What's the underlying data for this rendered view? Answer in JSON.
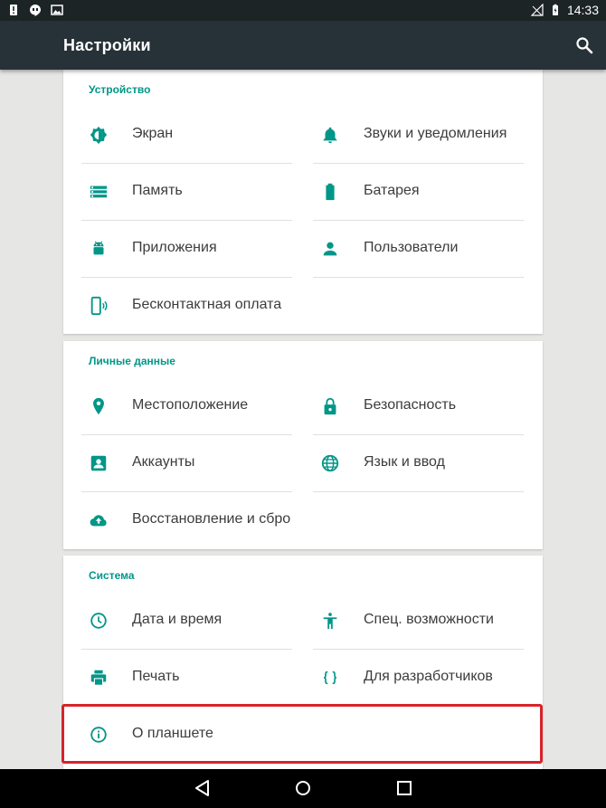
{
  "status_bar": {
    "time": "14:33"
  },
  "app_bar": {
    "title": "Настройки"
  },
  "sections": [
    {
      "title": "Устройство",
      "items": [
        {
          "label": "Экран",
          "icon": "brightness-icon"
        },
        {
          "label": "Звуки и уведомления",
          "icon": "bell-icon"
        },
        {
          "label": "Память",
          "icon": "storage-icon"
        },
        {
          "label": "Батарея",
          "icon": "battery-icon"
        },
        {
          "label": "Приложения",
          "icon": "android-icon"
        },
        {
          "label": "Пользователи",
          "icon": "person-icon"
        },
        {
          "label": "Бесконтактная оплата",
          "icon": "nfc-phone-icon"
        }
      ]
    },
    {
      "title": "Личные данные",
      "items": [
        {
          "label": "Местоположение",
          "icon": "location-pin-icon"
        },
        {
          "label": "Безопасность",
          "icon": "lock-icon"
        },
        {
          "label": "Аккаунты",
          "icon": "account-box-icon"
        },
        {
          "label": "Язык и ввод",
          "icon": "globe-icon"
        },
        {
          "label": "Восстановление и сбро",
          "icon": "cloud-upload-icon"
        }
      ]
    },
    {
      "title": "Система",
      "items": [
        {
          "label": "Дата и время",
          "icon": "clock-icon"
        },
        {
          "label": "Спец. возможности",
          "icon": "accessibility-icon"
        },
        {
          "label": "Печать",
          "icon": "printer-icon"
        },
        {
          "label": "Для разработчиков",
          "icon": "code-braces-icon"
        },
        {
          "label": "О планшете",
          "icon": "info-icon"
        }
      ]
    }
  ],
  "colors": {
    "accent": "#009688",
    "app_bar": "#263238",
    "highlight": "#d8232a"
  }
}
